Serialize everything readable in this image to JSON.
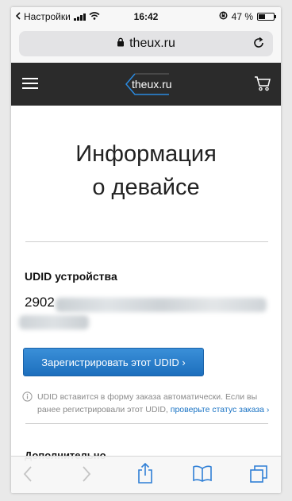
{
  "status_bar": {
    "carrier": "Настройки",
    "time": "16:42",
    "battery_percent": "47 %",
    "battery_level": 0.47
  },
  "browser": {
    "url": "theux.ru"
  },
  "site": {
    "logo_text": "theux.ru"
  },
  "content": {
    "title_line1": "Информация",
    "title_line2": "о девайсе",
    "udid_label": "UDID устройства",
    "udid_value_visible": "2902",
    "register_button": "Зарегистрировать этот UDID ›",
    "info_text": "UDID вставится в форму заказа автоматически. Если вы ранее регистрировали этот UDID, ",
    "info_link": "проверьте статус заказа ›",
    "more_heading": "Дополнительно"
  },
  "toolbar": {
    "icons": [
      "back-icon",
      "forward-icon",
      "share-icon",
      "bookmarks-icon",
      "tabs-icon"
    ]
  },
  "colors": {
    "header_bg": "#2b2b2b",
    "button_blue": "#2a7fcf",
    "link_blue": "#1a73c4",
    "ios_blue": "#2f7fd6"
  }
}
